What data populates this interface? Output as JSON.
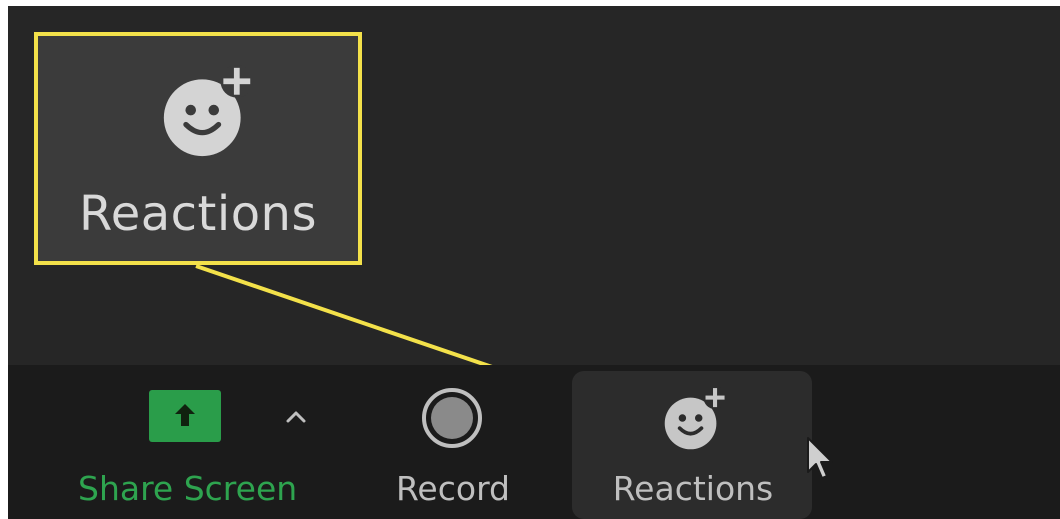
{
  "callout": {
    "label": "Reactions",
    "icon": "emoji-add-icon",
    "highlight_color": "#f3e14a"
  },
  "toolbar": {
    "share_screen": {
      "label": "Share Screen",
      "icon": "share-up-arrow-icon",
      "color": "#2ea44f"
    },
    "share_options": {
      "icon": "caret-up-icon"
    },
    "record": {
      "label": "Record",
      "icon": "record-icon"
    },
    "reactions": {
      "label": "Reactions",
      "icon": "emoji-add-icon"
    }
  },
  "pointer": {
    "icon": "mouse-cursor-icon"
  }
}
